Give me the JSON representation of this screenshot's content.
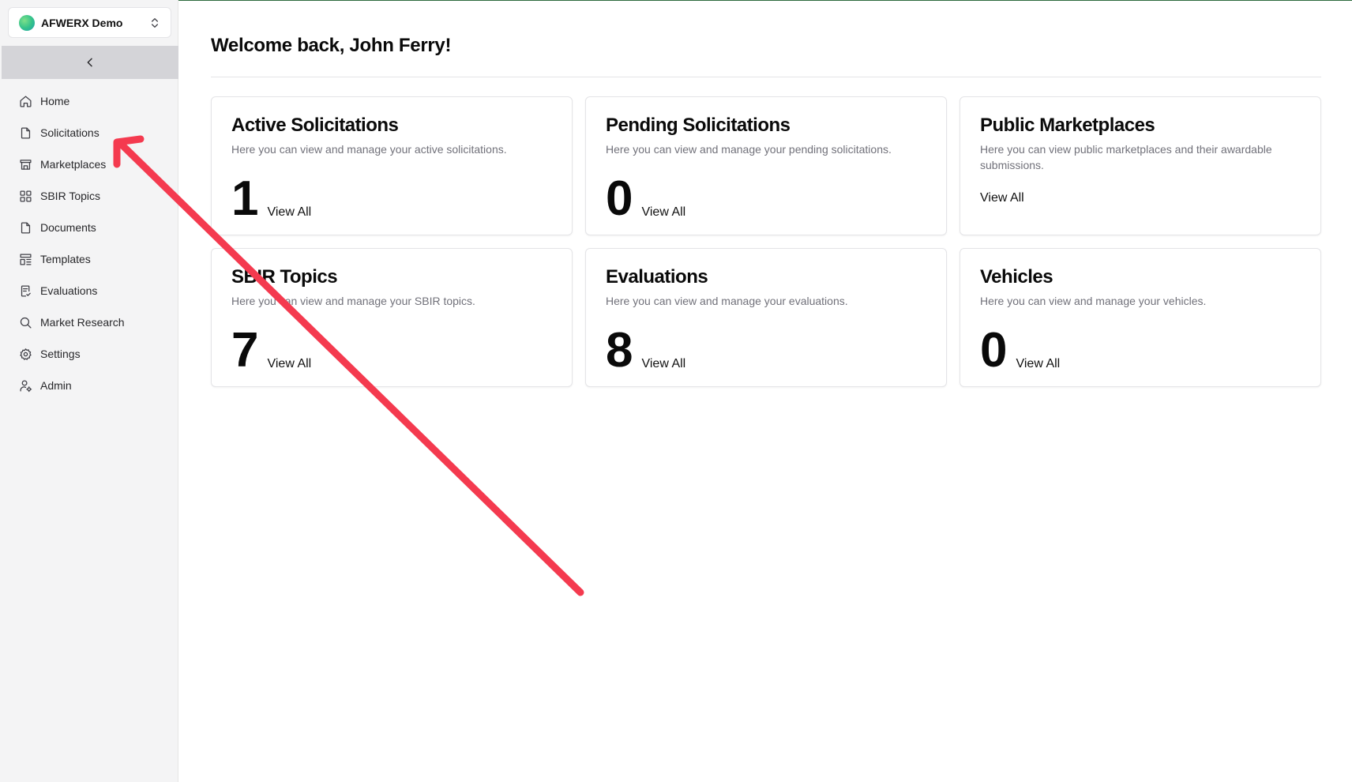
{
  "org": {
    "name": "AFWERX Demo"
  },
  "sidebar": {
    "items": [
      {
        "label": "Home",
        "icon": "home-icon"
      },
      {
        "label": "Solicitations",
        "icon": "document-icon"
      },
      {
        "label": "Marketplaces",
        "icon": "store-icon"
      },
      {
        "label": "SBIR Topics",
        "icon": "grid-icon"
      },
      {
        "label": "Documents",
        "icon": "document-icon"
      },
      {
        "label": "Templates",
        "icon": "template-icon"
      },
      {
        "label": "Evaluations",
        "icon": "clipboard-check-icon"
      },
      {
        "label": "Market Research",
        "icon": "search-icon"
      },
      {
        "label": "Settings",
        "icon": "gear-icon"
      },
      {
        "label": "Admin",
        "icon": "user-gear-icon"
      }
    ]
  },
  "main": {
    "welcome": "Welcome back, John Ferry!",
    "cards": [
      {
        "title": "Active Solicitations",
        "description": "Here you can view and manage your active solicitations.",
        "count": "1",
        "action": "View All"
      },
      {
        "title": "Pending Solicitations",
        "description": "Here you can view and manage your pending solicitations.",
        "count": "0",
        "action": "View All"
      },
      {
        "title": "Public Marketplaces",
        "description": "Here you can view public marketplaces and their awardable submissions.",
        "action": "View All"
      },
      {
        "title": "SBIR Topics",
        "description": "Here you can view and manage your SBIR topics.",
        "count": "7",
        "action": "View All"
      },
      {
        "title": "Evaluations",
        "description": "Here you can view and manage your evaluations.",
        "count": "8",
        "action": "View All"
      },
      {
        "title": "Vehicles",
        "description": "Here you can view and manage your vehicles.",
        "count": "0",
        "action": "View All"
      }
    ]
  },
  "annotation": {
    "color": "#f43a4f"
  }
}
